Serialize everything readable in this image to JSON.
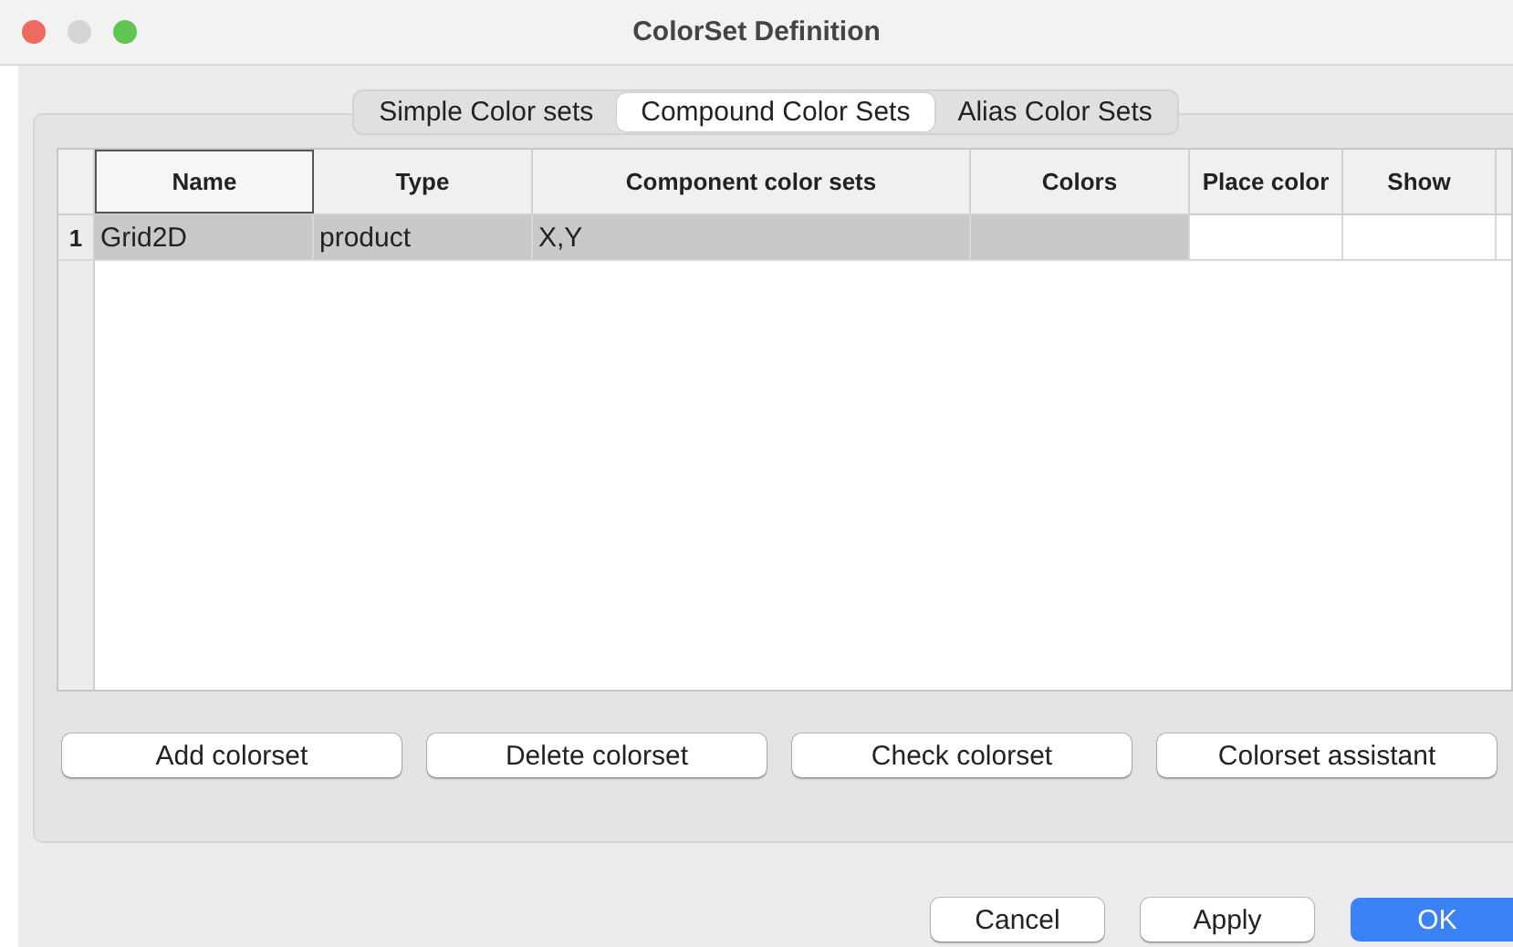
{
  "window": {
    "title": "ColorSet Definition"
  },
  "tabs": [
    {
      "label": "Simple Color sets",
      "selected": false
    },
    {
      "label": "Compound Color Sets",
      "selected": true
    },
    {
      "label": "Alias Color Sets",
      "selected": false
    }
  ],
  "table": {
    "columns": [
      "Name",
      "Type",
      "Component color sets",
      "Colors",
      "Place color",
      "Show"
    ],
    "rows": [
      {
        "number": "1",
        "selected": true,
        "cells": [
          "Grid2D",
          "product",
          "X,Y",
          "",
          "",
          ""
        ]
      }
    ]
  },
  "panel_buttons": [
    "Add colorset",
    "Delete colorset",
    "Check colorset",
    "Colorset assistant"
  ],
  "dialog_buttons": [
    {
      "label": "Cancel",
      "kind": "normal"
    },
    {
      "label": "Apply",
      "kind": "normal"
    },
    {
      "label": "OK",
      "kind": "default"
    }
  ]
}
